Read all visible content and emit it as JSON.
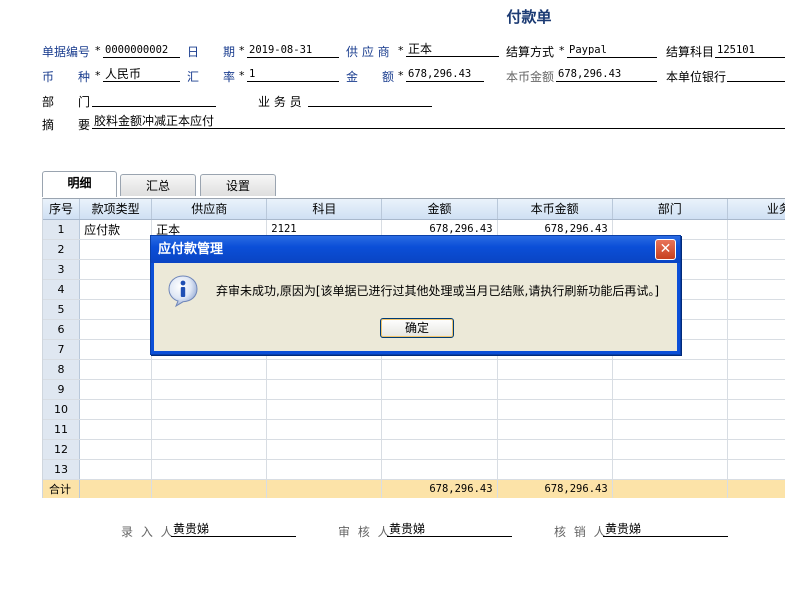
{
  "title": "付款单",
  "header": {
    "doc_no": {
      "label": "单据编号",
      "value": "0000000002"
    },
    "date": {
      "label": "日　　期",
      "value": "2019-08-31"
    },
    "supplier": {
      "label": "供 应 商",
      "value": "正本"
    },
    "settle_method": {
      "label": "结算方式",
      "value": "Paypal"
    },
    "settle_account": {
      "label": "结算科目",
      "value": "125101"
    },
    "currency": {
      "label": "币　　种",
      "value": "人民币"
    },
    "rate": {
      "label": "汇　　率",
      "value": "1"
    },
    "amount": {
      "label": "金　　额",
      "value": "678,296.43"
    },
    "local_amount": {
      "label": "本币金额",
      "value": "678,296.43"
    },
    "bank": {
      "label": "本单位银行",
      "value": ""
    },
    "dept": {
      "label": "部　　门",
      "value": ""
    },
    "salesman": {
      "label": "业 务 员",
      "value": ""
    },
    "memo": {
      "label": "摘　　要",
      "value": "胶料金额冲减正本应付"
    },
    "required_mark": "*"
  },
  "tabs": [
    {
      "label": "明细"
    },
    {
      "label": "汇总"
    },
    {
      "label": "设置"
    }
  ],
  "grid": {
    "columns": [
      "序号",
      "款项类型",
      "供应商",
      "科目",
      "金额",
      "本币金额",
      "部门",
      "业务员"
    ],
    "rows": [
      [
        "1",
        "应付款",
        "正本",
        "2121",
        "678,296.43",
        "678,296.43",
        "",
        ""
      ],
      [
        "2",
        "",
        "",
        "",
        "",
        "",
        "",
        ""
      ],
      [
        "3",
        "",
        "",
        "",
        "",
        "",
        "",
        ""
      ],
      [
        "4",
        "",
        "",
        "",
        "",
        "",
        "",
        ""
      ],
      [
        "5",
        "",
        "",
        "",
        "",
        "",
        "",
        ""
      ],
      [
        "6",
        "",
        "",
        "",
        "",
        "",
        "",
        ""
      ],
      [
        "7",
        "",
        "",
        "",
        "",
        "",
        "",
        ""
      ],
      [
        "8",
        "",
        "",
        "",
        "",
        "",
        "",
        ""
      ],
      [
        "9",
        "",
        "",
        "",
        "",
        "",
        "",
        ""
      ],
      [
        "10",
        "",
        "",
        "",
        "",
        "",
        "",
        ""
      ],
      [
        "11",
        "",
        "",
        "",
        "",
        "",
        "",
        ""
      ],
      [
        "12",
        "",
        "",
        "",
        "",
        "",
        "",
        ""
      ],
      [
        "13",
        "",
        "",
        "",
        "",
        "",
        "",
        ""
      ]
    ],
    "total": {
      "label": "合计",
      "amount": "678,296.43",
      "local_amount": "678,296.43"
    }
  },
  "signatures": {
    "entered_by": {
      "label": "录 入 人",
      "value": "黄贵娣"
    },
    "reviewed_by": {
      "label": "审 核 人",
      "value": "黄贵娣"
    },
    "written_off_by": {
      "label": "核 销 人",
      "value": "黄贵娣"
    }
  },
  "dialog": {
    "title": "应付款管理",
    "message": "弃审未成功,原因为[该单据已进行过其他处理或当月已结账,请执行刷新功能后再试。]",
    "ok_label": "确定",
    "close_glyph": "✕",
    "icon": "info-icon"
  },
  "colors": {
    "title": "#1b3a73",
    "dialog_titlebar": "#0b4fd8",
    "total_row": "#fce3a8",
    "grid_header": "#cfe0f3",
    "row_number": "#dfe7f1"
  }
}
